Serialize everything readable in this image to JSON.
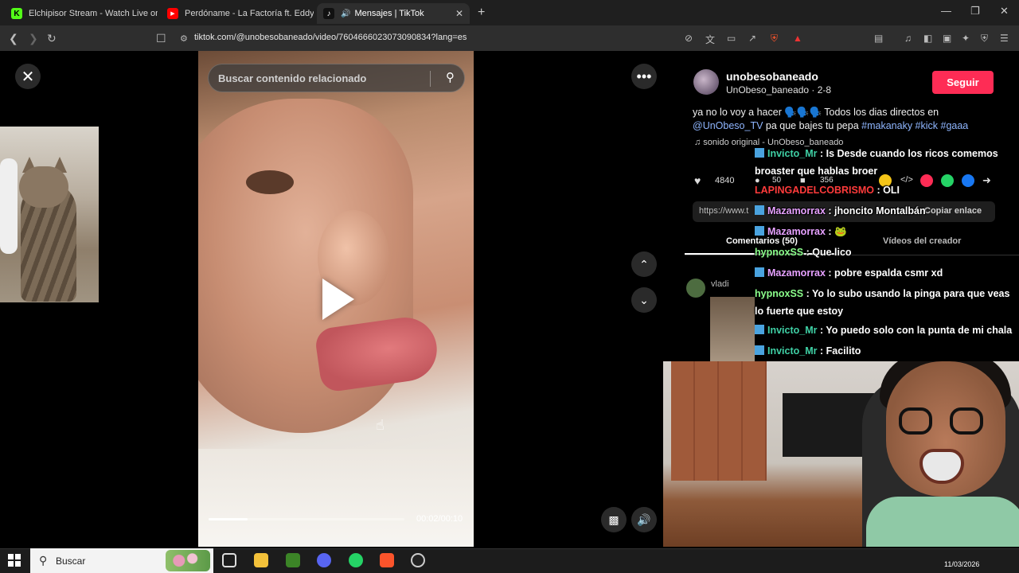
{
  "browser": {
    "tabs": [
      {
        "label": "Elchipisor Stream - Watch Live on Kic",
        "fav": "K",
        "fav_color": "#53fc18"
      },
      {
        "label": "Perdóname - La Factoría ft. Eddy Lov",
        "fav": "▶",
        "fav_color": "#ff0000"
      },
      {
        "label": "Mensajes | TikTok",
        "fav": "♪",
        "fav_color": "#111111"
      }
    ],
    "url": "tiktok.com/@unobesobaneado/video/7604666023073090834?lang=es"
  },
  "video": {
    "search_placeholder": "Buscar contenido relacionado",
    "time": "00:02/00:10",
    "progress": 0.2
  },
  "author": {
    "username": "unobesobaneado",
    "handle_date": "UnObeso_baneado · 2-8",
    "follow_label": "Seguir"
  },
  "description": {
    "text_1": "ya no lo voy a hacer 🗣️🗣️🗣️ Todos los dias directos en",
    "mention": "@UnObeso_TV",
    "text_2": " pa que bajes tu pepa ",
    "tags": "#makanaky #kick #gaaa"
  },
  "sound": "♫  sonido original - UnObeso_baneado",
  "stats": {
    "likes": "4840",
    "comments": "50",
    "saves": "356"
  },
  "share": {
    "url_partial": "https://www.t",
    "copy_label": "Copiar enlace"
  },
  "tabs": {
    "comments": "Comentarios (50)",
    "creator_videos": "Vídeos del creador"
  },
  "comment": {
    "user": "vladi"
  },
  "chat": [
    {
      "user": "Invicto_Mr",
      "color": "green",
      "badge": true,
      "text": " : Is Desde cuando los ricos comemos broaster que hablas broer"
    },
    {
      "user": "LAPINGADELCOBRISMO",
      "color": "red",
      "badge": false,
      "text": " : OLI"
    },
    {
      "user": "Mazamorrax",
      "color": "pink",
      "badge": true,
      "text": " : jhoncito Montalbán"
    },
    {
      "user": "Mazamorrax",
      "color": "pink",
      "badge": true,
      "text": " : 🐸"
    },
    {
      "user": "hypnoxSS",
      "color": "lime",
      "badge": false,
      "text": " : Que lico"
    },
    {
      "user": "Mazamorrax",
      "color": "pink",
      "badge": true,
      "text": " : pobre espalda csmr xd"
    },
    {
      "user": "hypnoxSS",
      "color": "lime",
      "badge": false,
      "text": " : Yo lo subo usando la pinga para que veas lo fuerte que estoy"
    },
    {
      "user": "Invicto_Mr",
      "color": "green",
      "badge": true,
      "text": " : Yo puedo solo con la punta de mi chala"
    },
    {
      "user": "Invicto_Mr",
      "color": "green",
      "badge": true,
      "text": " : Facilito"
    }
  ],
  "taskbar": {
    "search_label": "Buscar",
    "date": "11/03/2026"
  }
}
